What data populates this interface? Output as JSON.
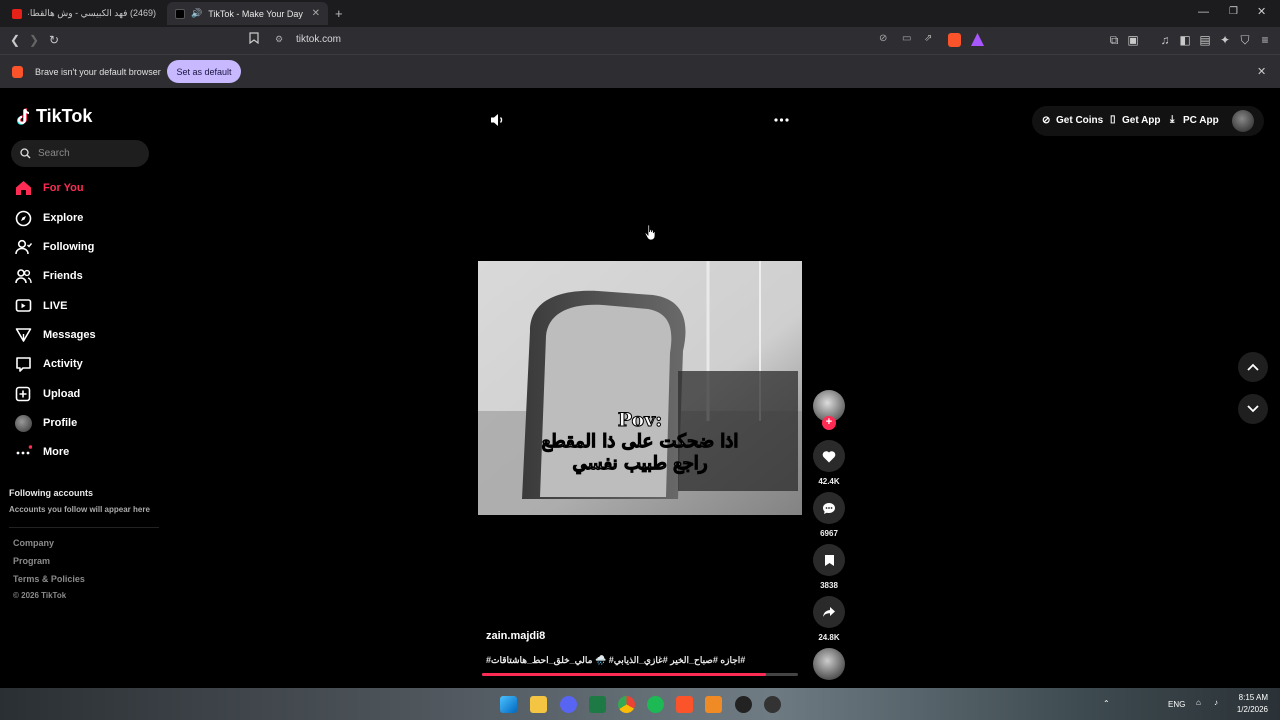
{
  "browser": {
    "tabs": [
      {
        "title": "(2469) فهد الكبيسي - وش هالقطاعه (l)",
        "active": false
      },
      {
        "title": "TikTok - Make Your Day",
        "active": true
      }
    ],
    "new_tab_glyph": "+",
    "url": "tiktok.com",
    "infobar": {
      "message": "Brave isn't your default browser",
      "button": "Set as default"
    }
  },
  "sidebar": {
    "logo": "TikTok",
    "search_placeholder": "Search",
    "nav": [
      {
        "label": "For You",
        "icon": "home-icon",
        "active": true
      },
      {
        "label": "Explore",
        "icon": "compass-icon"
      },
      {
        "label": "Following",
        "icon": "following-icon"
      },
      {
        "label": "Friends",
        "icon": "friends-icon"
      },
      {
        "label": "LIVE",
        "icon": "live-icon"
      },
      {
        "label": "Messages",
        "icon": "messages-icon"
      },
      {
        "label": "Activity",
        "icon": "activity-icon"
      },
      {
        "label": "Upload",
        "icon": "upload-icon"
      },
      {
        "label": "Profile",
        "icon": "profile-avatar"
      },
      {
        "label": "More",
        "icon": "more-icon"
      }
    ],
    "following_title": "Following accounts",
    "following_hint": "Accounts you follow will appear here",
    "footer": [
      "Company",
      "Program",
      "Terms & Policies"
    ],
    "copyright": "© 2026 TikTok"
  },
  "header_right": {
    "get_coins": "Get Coins",
    "get_app": "Get App",
    "pc_app": "PC App"
  },
  "video": {
    "caption_line1": "Pov:",
    "caption_line2": "اذا ضحكت على ذا المقطع",
    "caption_line3": "راجع طبيب نفسي",
    "author": "zain.majdi8",
    "description": "#اجازه #صباح_الخير #غازي_الذيابي# 🌧️ مالي_خلق_احط_هاشتاقات#",
    "progress": 0.9
  },
  "actions": {
    "likes": "42.4K",
    "comments": "6967",
    "saves": "3838",
    "shares": "24.8K"
  },
  "taskbar": {
    "lang": "ENG",
    "time": "8:15 AM",
    "date": "1/2/2026"
  },
  "colors": {
    "accent": "#fe2c55",
    "infobar_button": "#c7b8ff"
  }
}
